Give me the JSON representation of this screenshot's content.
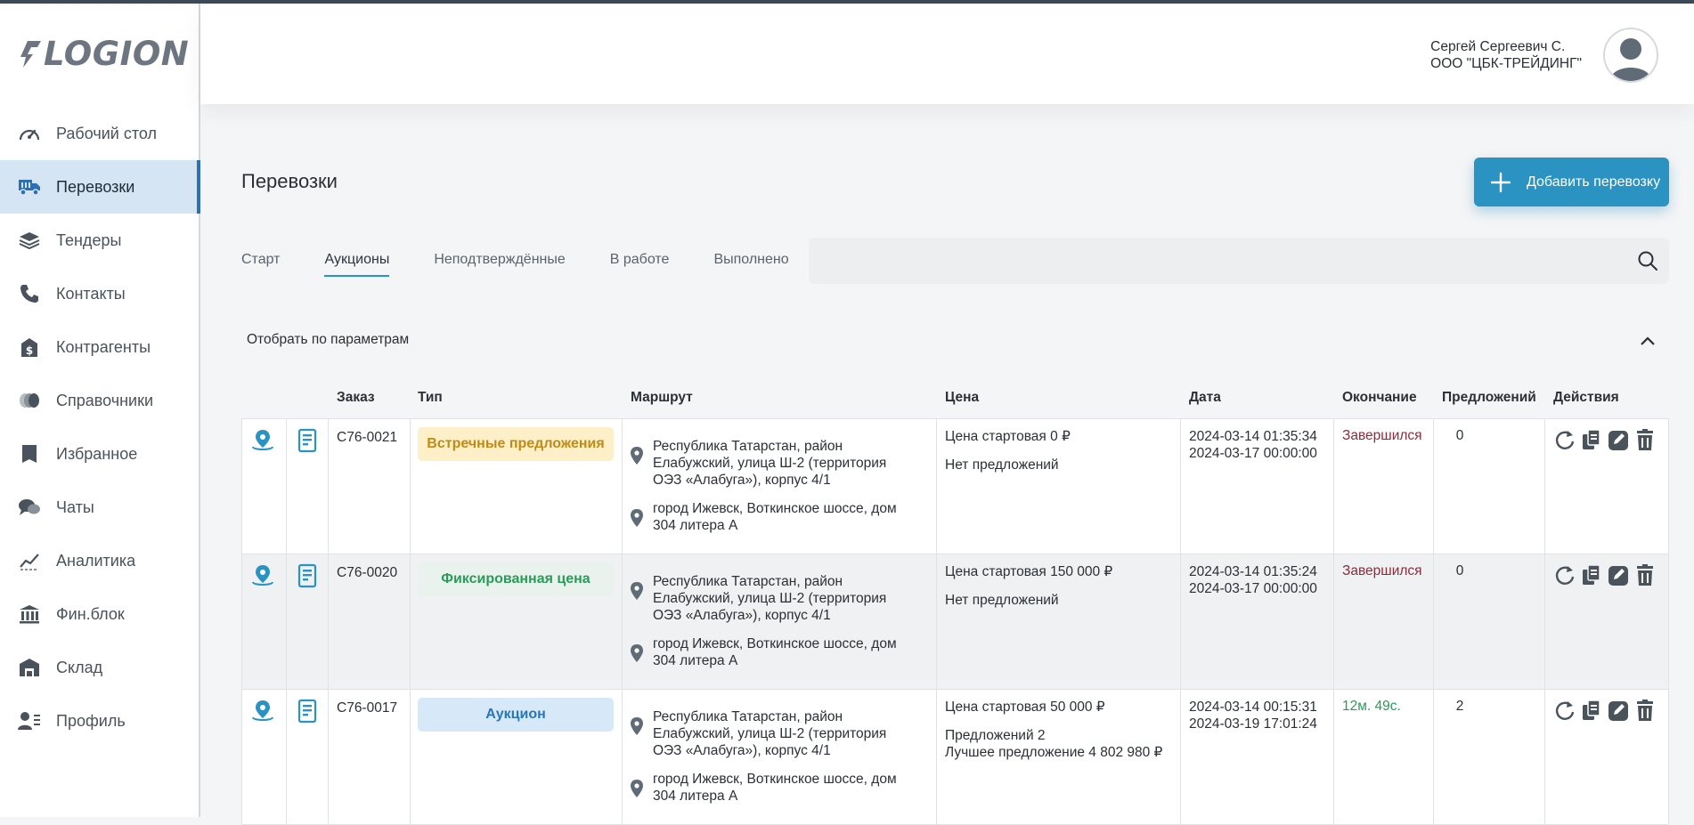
{
  "app": {
    "logo_text": "LOGION"
  },
  "user": {
    "name": "Сергей Сергеевич С.",
    "company": "ООО \"ЦБК-ТРЕЙДИНГ\""
  },
  "sidebar": {
    "items": [
      {
        "label": "Рабочий стол",
        "icon": "dashboard-gauge-icon"
      },
      {
        "label": "Перевозки",
        "icon": "truck-icon",
        "active": true
      },
      {
        "label": "Тендеры",
        "icon": "layers-icon"
      },
      {
        "label": "Контакты",
        "icon": "phone-icon"
      },
      {
        "label": "Контрагенты",
        "icon": "building-money-icon"
      },
      {
        "label": "Справочники",
        "icon": "coins-icon"
      },
      {
        "label": "Избранное",
        "icon": "bookmark-icon"
      },
      {
        "label": "Чаты",
        "icon": "chat-icon"
      },
      {
        "label": "Аналитика",
        "icon": "chart-icon"
      },
      {
        "label": "Фин.блок",
        "icon": "bank-icon"
      },
      {
        "label": "Склад",
        "icon": "warehouse-icon"
      },
      {
        "label": "Профиль",
        "icon": "profile-list-icon"
      }
    ]
  },
  "main": {
    "title": "Перевозки",
    "add_button": "Добавить перевозку",
    "tabs": [
      {
        "label": "Старт"
      },
      {
        "label": "Аукционы",
        "active": true
      },
      {
        "label": "Неподтверждённые"
      },
      {
        "label": "В работе"
      },
      {
        "label": "Выполнено"
      }
    ],
    "search": {
      "value": "",
      "placeholder": ""
    },
    "filter_label": "Отобрать по параметрам"
  },
  "table": {
    "columns": [
      "Заказ",
      "Тип",
      "Маршрут",
      "Цена",
      "Дата",
      "Окончание",
      "Предложений",
      "Действия"
    ],
    "rows": [
      {
        "order": "С76-0021",
        "type": "Встречные предложения",
        "route_from": "Республика Татарстан, район Елабужский, улица Ш-2 (территория ОЭЗ «Алабуга»), корпус 4/1",
        "route_to": "город Ижевск, Воткинское шоссе, дом 304 литера А",
        "price_line1": "Цена стартовая 0 ₽",
        "price_line2": "Нет предложений",
        "price_line3": "",
        "date_start": "2024-03-14 01:35:34",
        "date_end": "2024-03-17 00:00:00",
        "ending": "Завершился",
        "offers": "0"
      },
      {
        "order": "С76-0020",
        "type": "Фиксированная цена",
        "route_from": "Республика Татарстан, район Елабужский, улица Ш-2 (территория ОЭЗ «Алабуга»), корпус 4/1",
        "route_to": "город Ижевск, Воткинское шоссе, дом 304 литера А",
        "price_line1": "Цена стартовая 150 000 ₽",
        "price_line2": "Нет предложений",
        "price_line3": "",
        "date_start": "2024-03-14 01:35:24",
        "date_end": "2024-03-17 00:00:00",
        "ending": "Завершился",
        "offers": "0"
      },
      {
        "order": "С76-0017",
        "type": "Аукцион",
        "route_from": "Республика Татарстан, район Елабужский, улица Ш-2 (территория ОЭЗ «Алабуга»), корпус 4/1",
        "route_to": "город Ижевск, Воткинское шоссе, дом 304 литера А",
        "price_line1": "Цена стартовая 50 000 ₽",
        "price_line2": "Предложений 2",
        "price_line3": "Лучшее предложение 4 802 980 ₽",
        "date_start": "2024-03-14 00:15:31",
        "date_end": "2024-03-19 17:01:24",
        "ending": "12м. 49с.",
        "offers": "2"
      }
    ]
  },
  "colors": {
    "accent": "#2a93c2",
    "active_nav_bg": "#d6e5f3",
    "ended": "#8a2d3b",
    "running": "#2c9a5a",
    "badge_counter_bg": "#fdf0c8",
    "badge_counter_fg": "#c08a16",
    "badge_fixed_bg": "#e9f2ec",
    "badge_fixed_fg": "#2c9a5a",
    "badge_auction_bg": "#d7e9f8",
    "badge_auction_fg": "#2a76b5"
  }
}
